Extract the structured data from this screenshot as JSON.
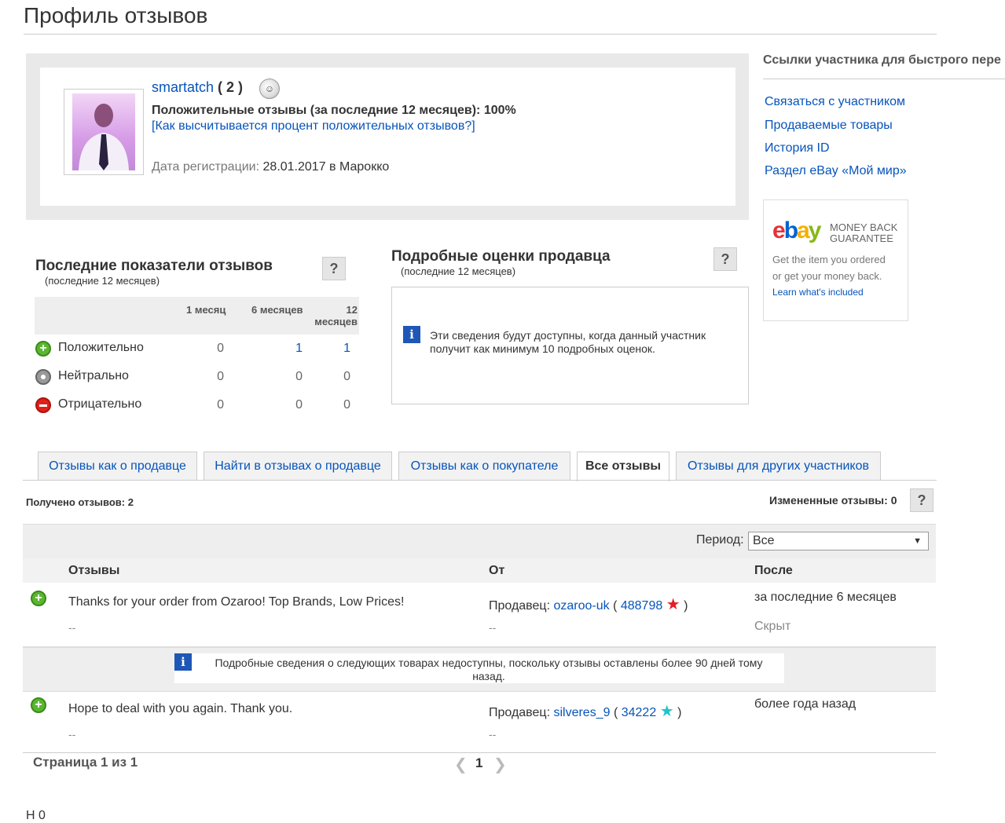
{
  "page": {
    "title": "Профиль отзывов"
  },
  "profile": {
    "username": "smartatch",
    "score": "( 2 )",
    "positive_feedback": "Положительные отзывы (за последние 12 месяцев): 100%",
    "calc_link": "[Как высчитывается процент положительных отзывов?]",
    "reg_label": "Дата регистрации:",
    "reg_value": "28.01.2017 в Марокко"
  },
  "sidebar": {
    "title": "Ссылки участника для быстрого пере",
    "links": [
      "Связаться с участником",
      "Продаваемые товары",
      "История ID",
      "Раздел eBay «Мой мир»"
    ],
    "mbg": {
      "logo": [
        "e",
        "b",
        "a",
        "y"
      ],
      "tag_line1": "MONEY BACK",
      "tag_line2": "GUARANTEE",
      "line1": "Get the item you ordered",
      "line2": "or get your money back.",
      "link": "Learn what's included"
    }
  },
  "recent": {
    "title": "Последние показатели отзывов",
    "subtitle": "(последние 12 месяцев)",
    "help": "?",
    "columns": [
      "1 месяц",
      "6 месяцев",
      "12",
      "месяцев"
    ],
    "rows": [
      {
        "label": "Положительно",
        "m1": "0",
        "m6": "1",
        "m12": "1"
      },
      {
        "label": "Нейтрально",
        "m1": "0",
        "m6": "0",
        "m12": "0"
      },
      {
        "label": "Отрицательно",
        "m1": "0",
        "m6": "0",
        "m12": "0"
      }
    ]
  },
  "dsr": {
    "title": "Подробные оценки продавца",
    "subtitle": "(последние 12 месяцев)",
    "help": "?",
    "info_glyph": "i",
    "message": "Эти сведения будут доступны, когда данный участник получит как минимум 10 подробных оценок."
  },
  "tabs": [
    "Отзывы как о продавце",
    "Найти в отзывах о продавце",
    "Отзывы как о покупателе",
    "Все отзывы",
    "Отзывы для других участников"
  ],
  "summary": {
    "received": "Получено отзывов: 2",
    "revised": "Измененные отзывы: 0",
    "help": "?"
  },
  "filter": {
    "period_label": "Период:",
    "period_value": "Все",
    "arrow": "▼"
  },
  "columns": {
    "feedback": "Отзывы",
    "from": "От",
    "when": "После"
  },
  "feedback": [
    {
      "text": "Thanks for your order from Ozaroo! Top Brands, Low Prices!",
      "dash": "--",
      "from_label": "Продавец:",
      "seller": "ozaroo-uk",
      "paren_open": "(",
      "seller_score": "488798",
      "paren_close": ")",
      "when": "за последние 6 месяцев",
      "price": "Скрыт",
      "from_dash": "--",
      "star_color": "#e41b23"
    },
    {
      "text": "Hope to deal with you again. Thank you.",
      "dash": "--",
      "from_label": "Продавец:",
      "seller": "silveres_9",
      "paren_open": "(",
      "seller_score": "34222",
      "paren_close": ")",
      "when": "более года назад",
      "from_dash": "--",
      "star_color": "#21c4c8"
    }
  ],
  "notice": {
    "info_glyph": "i",
    "text": "Подробные сведения о следующих товарах недоступны, поскольку отзывы оставлены более 90 дней тому назад."
  },
  "pager": {
    "info": "Страница 1 из 1",
    "current": "1",
    "prev": "❮",
    "next": "❯"
  },
  "cut_text": "Н                                              0"
}
